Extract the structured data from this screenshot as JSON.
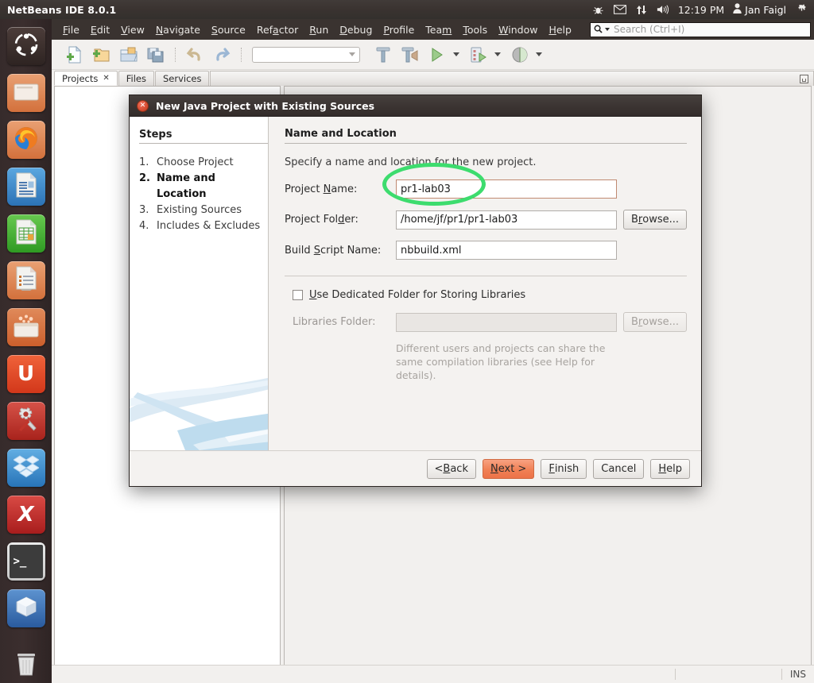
{
  "desktop": {
    "top_panel": {
      "app_title": "NetBeans IDE 8.0.1",
      "tray_icons": [
        "bug-icon",
        "mail-icon",
        "network-updown-icon",
        "volume-icon"
      ],
      "clock": "12:19 PM",
      "user_icon": "user-icon",
      "user_name": "Jan Faigl",
      "session_icon": "power-gear-icon"
    },
    "launcher": {
      "items": [
        {
          "name": "ubuntu-dash-icon",
          "glyph": "◌",
          "bg": "#3a2d2c",
          "fg": "#ffffff"
        },
        {
          "name": "files-folder-icon",
          "glyph": "▭",
          "bg": "#e08a4e",
          "fg": "#ffffff"
        },
        {
          "name": "firefox-icon",
          "glyph": "◉",
          "bg": "#e08a4e",
          "fg": "#2b6fc0"
        },
        {
          "name": "libreoffice-writer-icon",
          "glyph": "☰",
          "bg": "#3a85c8",
          "fg": "#ffffff"
        },
        {
          "name": "libreoffice-calc-icon",
          "glyph": "⊞",
          "bg": "#4aab3a",
          "fg": "#ffffff"
        },
        {
          "name": "libreoffice-impress-icon",
          "glyph": "▤",
          "bg": "#e0915c",
          "fg": "#ffffff"
        },
        {
          "name": "ubuntu-software-center-icon",
          "glyph": "▬",
          "bg": "#d9743c",
          "fg": "#ffffff"
        },
        {
          "name": "ubuntu-one-icon",
          "glyph": "U",
          "bg": "#e8552d",
          "fg": "#ffffff"
        },
        {
          "name": "system-settings-icon",
          "glyph": "⚙",
          "bg": "#c4402f",
          "fg": "#e8e8e8"
        },
        {
          "name": "dropbox-icon",
          "glyph": "⬢",
          "bg": "#3f90d8",
          "fg": "#ffffff"
        },
        {
          "name": "xmind-icon",
          "glyph": "X",
          "bg": "#c32f2f",
          "fg": "#ffffff"
        },
        {
          "name": "terminal-icon",
          "glyph": ">_",
          "bg": "#3b3b3b",
          "fg": "#ffffff"
        },
        {
          "name": "virtualbox-icon",
          "glyph": "■",
          "bg": "#3a6fb8",
          "fg": "#dfe8f2"
        },
        {
          "name": "trash-icon",
          "glyph": "⌵",
          "bg": "#4a4442",
          "fg": "#d8d4d0"
        }
      ]
    }
  },
  "netbeans": {
    "menu": [
      {
        "label": "File",
        "mnemonic": "F"
      },
      {
        "label": "Edit",
        "mnemonic": "E"
      },
      {
        "label": "View",
        "mnemonic": "V"
      },
      {
        "label": "Navigate",
        "mnemonic": "N"
      },
      {
        "label": "Source",
        "mnemonic": "S"
      },
      {
        "label": "Refactor",
        "mnemonic": "a"
      },
      {
        "label": "Run",
        "mnemonic": "R"
      },
      {
        "label": "Debug",
        "mnemonic": "D"
      },
      {
        "label": "Profile",
        "mnemonic": "P"
      },
      {
        "label": "Team",
        "mnemonic": "m"
      },
      {
        "label": "Tools",
        "mnemonic": "T"
      },
      {
        "label": "Window",
        "mnemonic": "W"
      },
      {
        "label": "Help",
        "mnemonic": "H"
      }
    ],
    "search": {
      "placeholder": "Search (Ctrl+I)",
      "value": "",
      "icon": "search-icon"
    },
    "toolbar": {
      "buttons": [
        "new-file-icon",
        "new-project-icon",
        "open-project-icon",
        "save-all-icon",
        "undo-icon",
        "redo-icon"
      ],
      "config_combo_value": "",
      "action_buttons": [
        "build-project-icon",
        "clean-and-build-icon",
        "run-project-icon",
        "debug-project-icon",
        "profile-project-icon"
      ]
    },
    "tabs": [
      {
        "label": "Projects",
        "closable": true,
        "active": true
      },
      {
        "label": "Files",
        "closable": false,
        "active": false
      },
      {
        "label": "Services",
        "closable": false,
        "active": false
      }
    ],
    "statusbar": {
      "left": "",
      "insert_mode": "INS"
    }
  },
  "dialog": {
    "title": "New Java Project with Existing Sources",
    "close_icon": "close-icon",
    "steps_heading": "Steps",
    "steps": [
      {
        "num": "1.",
        "label": "Choose Project",
        "current": false
      },
      {
        "num": "2.",
        "label": "Name and Location",
        "current": true
      },
      {
        "num": "3.",
        "label": "Existing Sources",
        "current": false
      },
      {
        "num": "4.",
        "label": "Includes & Excludes",
        "current": false
      }
    ],
    "main_title": "Name and Location",
    "main_desc": "Specify a name and location for the new project.",
    "fields": {
      "project_name": {
        "label_pre": "Project ",
        "label_mn": "N",
        "label_post": "ame:",
        "value": "pr1-lab03"
      },
      "project_folder": {
        "label_pre": "Project Fol",
        "label_mn": "d",
        "label_post": "er:",
        "value": "/home/jf/pr1/pr1-lab03",
        "browse": "Browse..."
      },
      "build_script": {
        "label_pre": "Build ",
        "label_mn": "S",
        "label_post": "cript Name:",
        "value": "nbbuild.xml"
      },
      "libraries_folder": {
        "label": "Libraries Folder:",
        "value": "",
        "browse": "Browse...",
        "disabled": true
      }
    },
    "dedicated_folder_checkbox": {
      "pre": "",
      "mn": "U",
      "post": "se Dedicated Folder for Storing Libraries",
      "checked": false
    },
    "libraries_hint": "Different users and projects can share the same compilation libraries (see Help for details).",
    "buttons": [
      {
        "pre": "< ",
        "mn": "B",
        "post": "ack",
        "name": "back-button",
        "style": "normal"
      },
      {
        "pre": "",
        "mn": "N",
        "post": "ext >",
        "name": "next-button",
        "style": "default"
      },
      {
        "pre": "",
        "mn": "F",
        "post": "inish",
        "name": "finish-button",
        "style": "normal"
      },
      {
        "pre": "Cancel",
        "mn": "",
        "post": "",
        "name": "cancel-button",
        "style": "normal"
      },
      {
        "pre": "",
        "mn": "H",
        "post": "elp",
        "name": "help-button",
        "style": "normal"
      }
    ]
  },
  "annotation": {
    "shape": "ellipse",
    "color": "#3ddc6e",
    "target": "project-name-field"
  }
}
